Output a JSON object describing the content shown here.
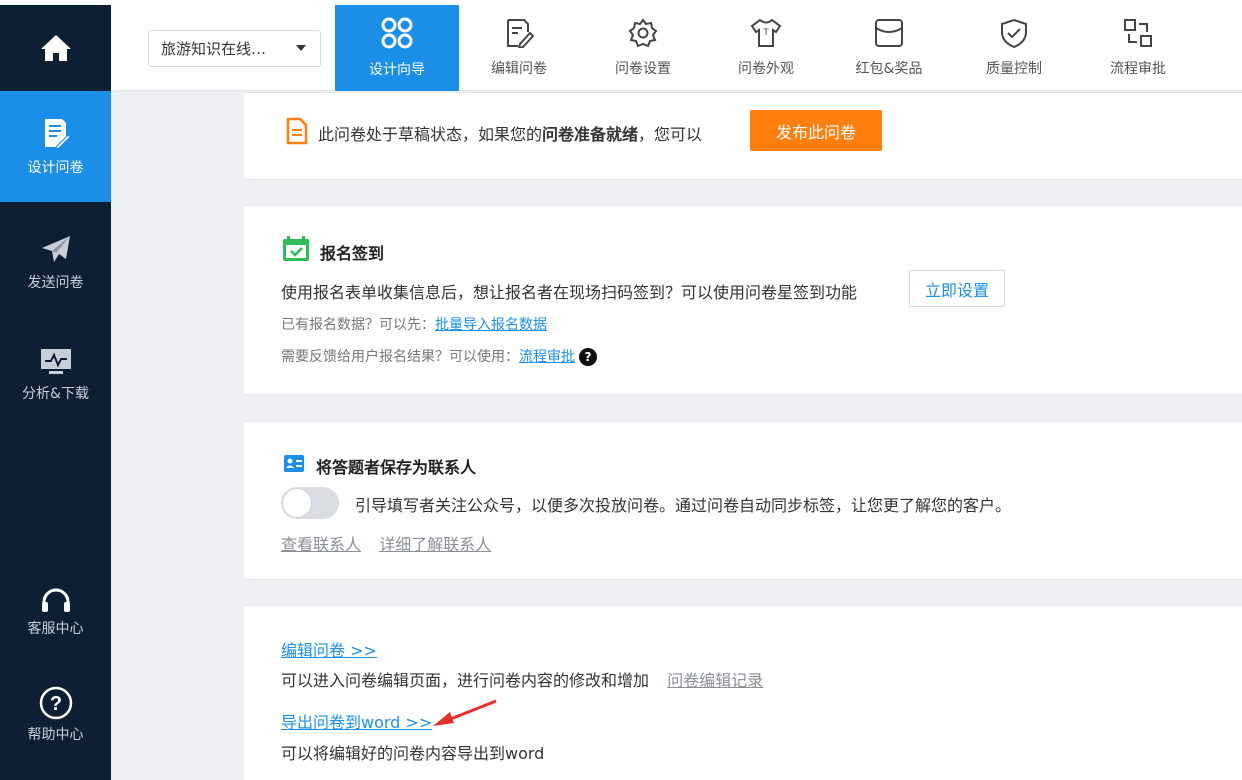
{
  "sidebar": {
    "home_icon": "home-icon",
    "items": [
      {
        "label": "设计问卷",
        "icon": "edit-document-icon"
      },
      {
        "label": "发送问卷",
        "icon": "paper-plane-icon"
      },
      {
        "label": "分析&下载",
        "icon": "chart-monitor-icon"
      },
      {
        "label": "客服中心",
        "icon": "headset-icon"
      },
      {
        "label": "帮助中心",
        "icon": "question-circle-icon"
      }
    ]
  },
  "topbar": {
    "survey_select": "旅游知识在线…",
    "tabs": [
      {
        "label": "设计向导",
        "icon": "grid-icon"
      },
      {
        "label": "编辑问卷",
        "icon": "edit-icon"
      },
      {
        "label": "问卷设置",
        "icon": "gear-icon"
      },
      {
        "label": "问卷外观",
        "icon": "shirt-icon"
      },
      {
        "label": "红包&奖品",
        "icon": "gift-box-icon"
      },
      {
        "label": "质量控制",
        "icon": "shield-check-icon"
      },
      {
        "label": "流程审批",
        "icon": "flow-icon"
      }
    ]
  },
  "draft": {
    "text_before": "此问卷处于草稿状态，如果您的",
    "text_bold": "问卷准备就绪",
    "text_after": "，您可以",
    "publish_button": "发布此问卷"
  },
  "signup": {
    "title": "报名签到",
    "desc": "使用报名表单收集信息后，想让报名者在现场扫码签到？可以使用问卷星签到功能",
    "setup_button": "立即设置",
    "import_prefix": "已有报名数据？可以先：",
    "import_link": "批量导入报名数据",
    "feedback_prefix": "需要反馈给用户报名结果？可以使用：",
    "feedback_link": "流程审批",
    "help_mark": "?"
  },
  "contacts": {
    "title": "将答题者保存为联系人",
    "toggle_desc": "引导填写者关注公众号，以便多次投放问卷。通过问卷自动同步标签，让您更了解您的客户。",
    "view_link": "查看联系人",
    "learn_link": "详细了解联系人"
  },
  "edit": {
    "edit_link": "编辑问卷 >>",
    "edit_desc": "可以进入问卷编辑页面，进行问卷内容的修改和增加",
    "history_link": "问卷编辑记录",
    "export_link": "导出问卷到word >>",
    "export_desc": "可以将编辑好的问卷内容导出到word"
  },
  "colors": {
    "accent": "#1b8fe8",
    "sidebar_bg": "#0f1f33",
    "publish": "#ff7f0e",
    "arrow": "#e8302a"
  }
}
